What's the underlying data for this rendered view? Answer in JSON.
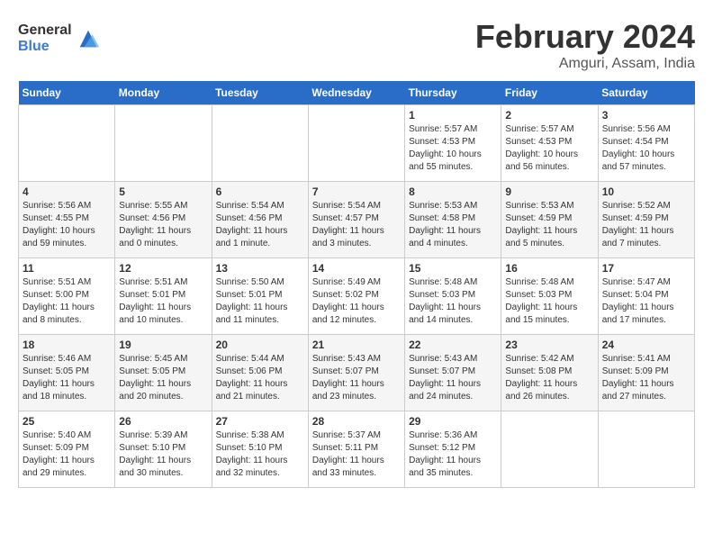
{
  "header": {
    "logo_general": "General",
    "logo_blue": "Blue",
    "month_title": "February 2024",
    "location": "Amguri, Assam, India"
  },
  "days_of_week": [
    "Sunday",
    "Monday",
    "Tuesday",
    "Wednesday",
    "Thursday",
    "Friday",
    "Saturday"
  ],
  "weeks": [
    [
      {
        "day": "",
        "info": ""
      },
      {
        "day": "",
        "info": ""
      },
      {
        "day": "",
        "info": ""
      },
      {
        "day": "",
        "info": ""
      },
      {
        "day": "1",
        "info": "Sunrise: 5:57 AM\nSunset: 4:53 PM\nDaylight: 10 hours and 55 minutes."
      },
      {
        "day": "2",
        "info": "Sunrise: 5:57 AM\nSunset: 4:53 PM\nDaylight: 10 hours and 56 minutes."
      },
      {
        "day": "3",
        "info": "Sunrise: 5:56 AM\nSunset: 4:54 PM\nDaylight: 10 hours and 57 minutes."
      }
    ],
    [
      {
        "day": "4",
        "info": "Sunrise: 5:56 AM\nSunset: 4:55 PM\nDaylight: 10 hours and 59 minutes."
      },
      {
        "day": "5",
        "info": "Sunrise: 5:55 AM\nSunset: 4:56 PM\nDaylight: 11 hours and 0 minutes."
      },
      {
        "day": "6",
        "info": "Sunrise: 5:54 AM\nSunset: 4:56 PM\nDaylight: 11 hours and 1 minute."
      },
      {
        "day": "7",
        "info": "Sunrise: 5:54 AM\nSunset: 4:57 PM\nDaylight: 11 hours and 3 minutes."
      },
      {
        "day": "8",
        "info": "Sunrise: 5:53 AM\nSunset: 4:58 PM\nDaylight: 11 hours and 4 minutes."
      },
      {
        "day": "9",
        "info": "Sunrise: 5:53 AM\nSunset: 4:59 PM\nDaylight: 11 hours and 5 minutes."
      },
      {
        "day": "10",
        "info": "Sunrise: 5:52 AM\nSunset: 4:59 PM\nDaylight: 11 hours and 7 minutes."
      }
    ],
    [
      {
        "day": "11",
        "info": "Sunrise: 5:51 AM\nSunset: 5:00 PM\nDaylight: 11 hours and 8 minutes."
      },
      {
        "day": "12",
        "info": "Sunrise: 5:51 AM\nSunset: 5:01 PM\nDaylight: 11 hours and 10 minutes."
      },
      {
        "day": "13",
        "info": "Sunrise: 5:50 AM\nSunset: 5:01 PM\nDaylight: 11 hours and 11 minutes."
      },
      {
        "day": "14",
        "info": "Sunrise: 5:49 AM\nSunset: 5:02 PM\nDaylight: 11 hours and 12 minutes."
      },
      {
        "day": "15",
        "info": "Sunrise: 5:48 AM\nSunset: 5:03 PM\nDaylight: 11 hours and 14 minutes."
      },
      {
        "day": "16",
        "info": "Sunrise: 5:48 AM\nSunset: 5:03 PM\nDaylight: 11 hours and 15 minutes."
      },
      {
        "day": "17",
        "info": "Sunrise: 5:47 AM\nSunset: 5:04 PM\nDaylight: 11 hours and 17 minutes."
      }
    ],
    [
      {
        "day": "18",
        "info": "Sunrise: 5:46 AM\nSunset: 5:05 PM\nDaylight: 11 hours and 18 minutes."
      },
      {
        "day": "19",
        "info": "Sunrise: 5:45 AM\nSunset: 5:05 PM\nDaylight: 11 hours and 20 minutes."
      },
      {
        "day": "20",
        "info": "Sunrise: 5:44 AM\nSunset: 5:06 PM\nDaylight: 11 hours and 21 minutes."
      },
      {
        "day": "21",
        "info": "Sunrise: 5:43 AM\nSunset: 5:07 PM\nDaylight: 11 hours and 23 minutes."
      },
      {
        "day": "22",
        "info": "Sunrise: 5:43 AM\nSunset: 5:07 PM\nDaylight: 11 hours and 24 minutes."
      },
      {
        "day": "23",
        "info": "Sunrise: 5:42 AM\nSunset: 5:08 PM\nDaylight: 11 hours and 26 minutes."
      },
      {
        "day": "24",
        "info": "Sunrise: 5:41 AM\nSunset: 5:09 PM\nDaylight: 11 hours and 27 minutes."
      }
    ],
    [
      {
        "day": "25",
        "info": "Sunrise: 5:40 AM\nSunset: 5:09 PM\nDaylight: 11 hours and 29 minutes."
      },
      {
        "day": "26",
        "info": "Sunrise: 5:39 AM\nSunset: 5:10 PM\nDaylight: 11 hours and 30 minutes."
      },
      {
        "day": "27",
        "info": "Sunrise: 5:38 AM\nSunset: 5:10 PM\nDaylight: 11 hours and 32 minutes."
      },
      {
        "day": "28",
        "info": "Sunrise: 5:37 AM\nSunset: 5:11 PM\nDaylight: 11 hours and 33 minutes."
      },
      {
        "day": "29",
        "info": "Sunrise: 5:36 AM\nSunset: 5:12 PM\nDaylight: 11 hours and 35 minutes."
      },
      {
        "day": "",
        "info": ""
      },
      {
        "day": "",
        "info": ""
      }
    ]
  ]
}
